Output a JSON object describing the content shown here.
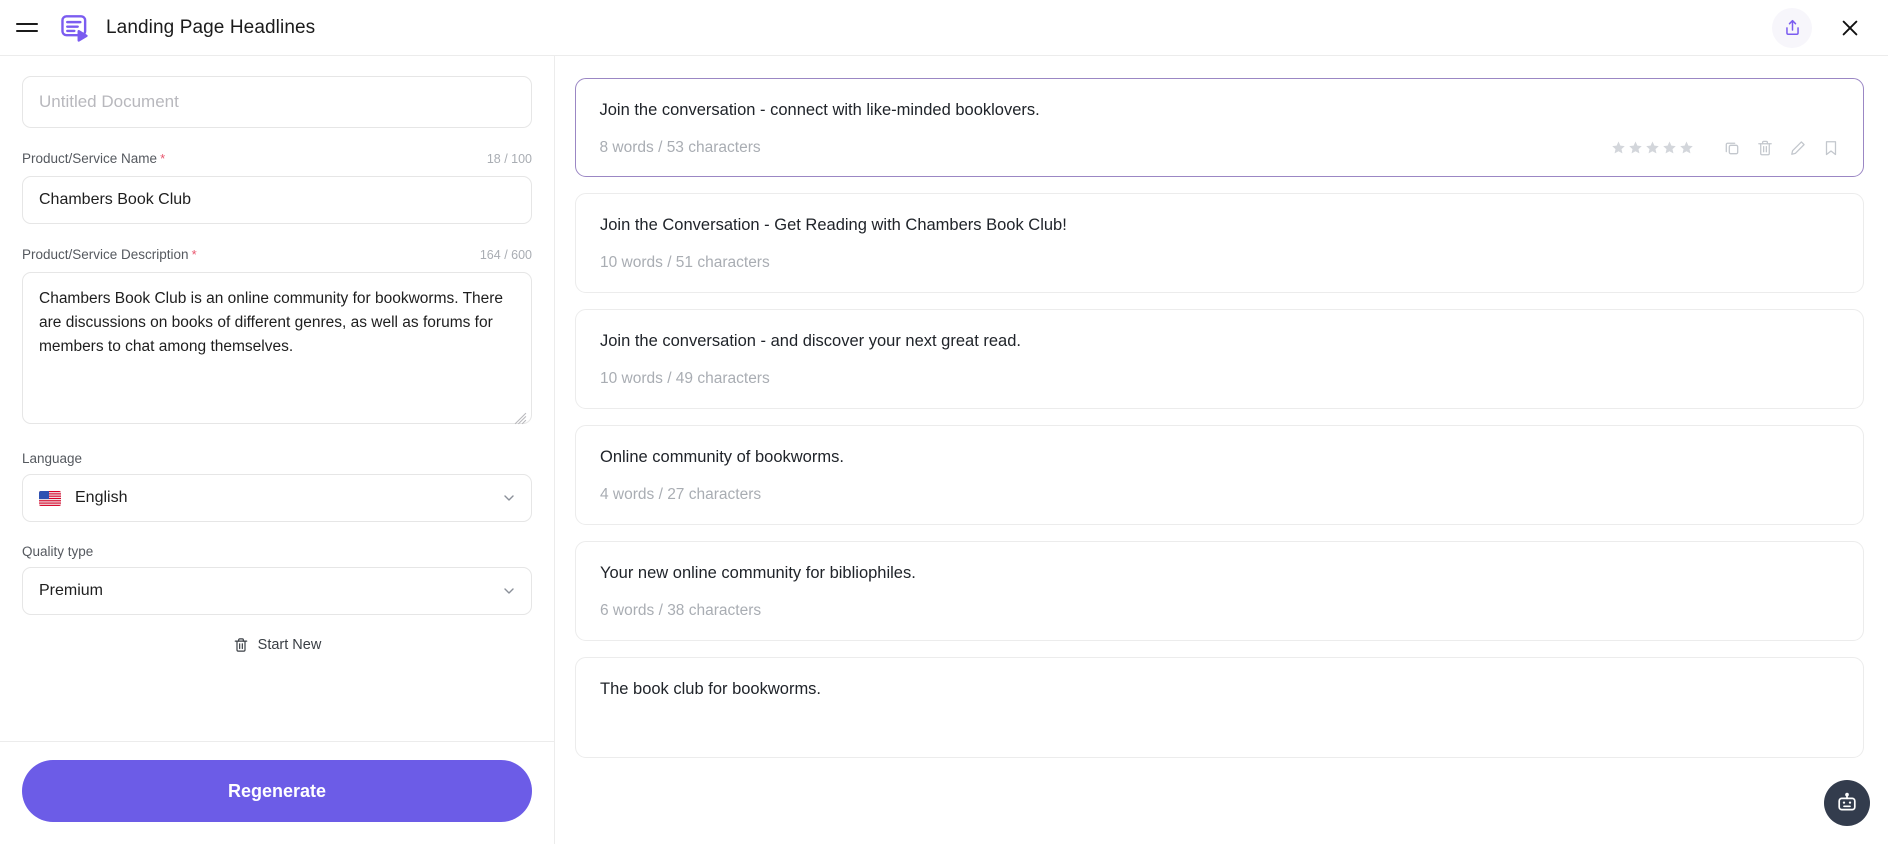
{
  "header": {
    "title": "Landing Page Headlines",
    "menu_icon": "hamburger-menu-icon",
    "logo_icon": "landing-page-headlines-logo-icon",
    "share_icon": "share-icon",
    "close_icon": "close-icon",
    "accent_color": "#6C5CE7"
  },
  "form": {
    "document_title": {
      "value": "",
      "placeholder": "Untitled Document"
    },
    "product_name": {
      "label": "Product/Service Name",
      "required_marker": "*",
      "counter": "18 / 100",
      "value": "Chambers Book Club",
      "placeholder": ""
    },
    "product_description": {
      "label": "Product/Service Description",
      "required_marker": "*",
      "counter": "164 / 600",
      "value": "Chambers Book Club is an online community for bookworms. There are discussions on books of different genres, as well as forums for members to chat among themselves.",
      "placeholder": ""
    },
    "language": {
      "label": "Language",
      "value": "English",
      "flag": "us-flag-icon",
      "chevron": "chevron-down-icon"
    },
    "quality_type": {
      "label": "Quality type",
      "value": "Premium",
      "chevron": "chevron-down-icon"
    },
    "start_new": {
      "label": "Start New",
      "icon": "trash-icon"
    },
    "regenerate": {
      "label": "Regenerate"
    }
  },
  "results": {
    "card_actions": {
      "star_icon": "star-icon",
      "star_count": 5,
      "copy_icon": "copy-icon",
      "delete_icon": "trash-icon",
      "edit_icon": "pencil-icon",
      "bookmark_icon": "bookmark-icon"
    },
    "items": [
      {
        "text": "Join the conversation - connect with like-minded booklovers.",
        "meta": "8 words / 53 characters",
        "selected": true,
        "show_actions": true
      },
      {
        "text": "Join the Conversation - Get Reading with Chambers Book Club!",
        "meta": "10 words / 51 characters",
        "selected": false,
        "show_actions": false
      },
      {
        "text": "Join the conversation - and discover your next great read.",
        "meta": "10 words / 49 characters",
        "selected": false,
        "show_actions": false
      },
      {
        "text": "Online community of bookworms.",
        "meta": "4 words / 27 characters",
        "selected": false,
        "show_actions": false
      },
      {
        "text": "Your new online community for bibliophiles.",
        "meta": "6 words / 38 characters",
        "selected": false,
        "show_actions": false
      },
      {
        "text": "The book club for bookworms.",
        "meta": "",
        "selected": false,
        "show_actions": false
      }
    ]
  },
  "chat_fab": {
    "icon": "robot-chat-icon",
    "color": "#333c4d"
  }
}
